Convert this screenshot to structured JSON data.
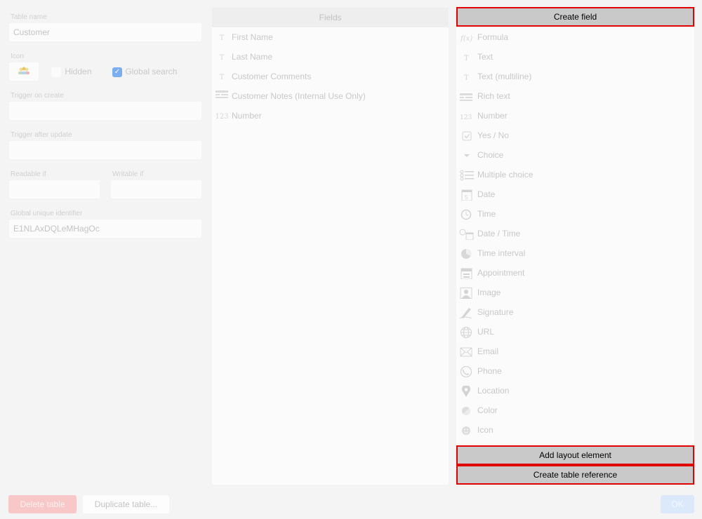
{
  "left": {
    "table_name_label": "Table name",
    "table_name_value": "Customer",
    "icon_label": "Icon",
    "hidden_label": "Hidden",
    "global_search_label": "Global search",
    "trigger_create_label": "Trigger on create",
    "trigger_update_label": "Trigger after update",
    "readable_if_label": "Readable if",
    "writable_if_label": "Writable if",
    "guid_label": "Global unique identifier",
    "guid_value": "E1NLAxDQLeMHagOc"
  },
  "fields": {
    "header": "Fields",
    "items": [
      {
        "icon": "T",
        "label": "First Name"
      },
      {
        "icon": "T",
        "label": "Last Name"
      },
      {
        "icon": "T",
        "label": "Customer Comments"
      },
      {
        "icon": "rich",
        "label": "Customer Notes (Internal Use Only)"
      },
      {
        "icon": "123",
        "label": "Number"
      }
    ]
  },
  "types": {
    "create_field": "Create field",
    "items": [
      {
        "icon": "formula-icon",
        "label": "Formula"
      },
      {
        "icon": "text-icon",
        "label": "Text"
      },
      {
        "icon": "text-icon",
        "label": "Text (multiline)"
      },
      {
        "icon": "rich-text-icon",
        "label": "Rich text"
      },
      {
        "icon": "number-icon",
        "label": "Number"
      },
      {
        "icon": "checkbox-icon",
        "label": "Yes / No"
      },
      {
        "icon": "triangle-down-icon",
        "label": "Choice"
      },
      {
        "icon": "list-icon",
        "label": "Multiple choice"
      },
      {
        "icon": "calendar-icon",
        "label": "Date"
      },
      {
        "icon": "clock-icon",
        "label": "Time"
      },
      {
        "icon": "date-time-icon",
        "label": "Date / Time"
      },
      {
        "icon": "interval-icon",
        "label": "Time interval"
      },
      {
        "icon": "appointment-icon",
        "label": "Appointment"
      },
      {
        "icon": "image-icon",
        "label": "Image"
      },
      {
        "icon": "signature-icon",
        "label": "Signature"
      },
      {
        "icon": "globe-icon",
        "label": "URL"
      },
      {
        "icon": "envelope-icon",
        "label": "Email"
      },
      {
        "icon": "phone-icon",
        "label": "Phone"
      },
      {
        "icon": "location-pin-icon",
        "label": "Location"
      },
      {
        "icon": "color-icon",
        "label": "Color"
      },
      {
        "icon": "smiley-icon",
        "label": "Icon"
      }
    ],
    "add_layout": "Add layout element",
    "create_reference": "Create table reference"
  },
  "footer": {
    "delete": "Delete table",
    "duplicate": "Duplicate table...",
    "ok": "OK"
  },
  "colors": {
    "highlight": "#e00000",
    "delete_button": "#f8c8c8",
    "ok_button": "#dbe9fb",
    "checkbox_checked": "#7aaef0"
  }
}
